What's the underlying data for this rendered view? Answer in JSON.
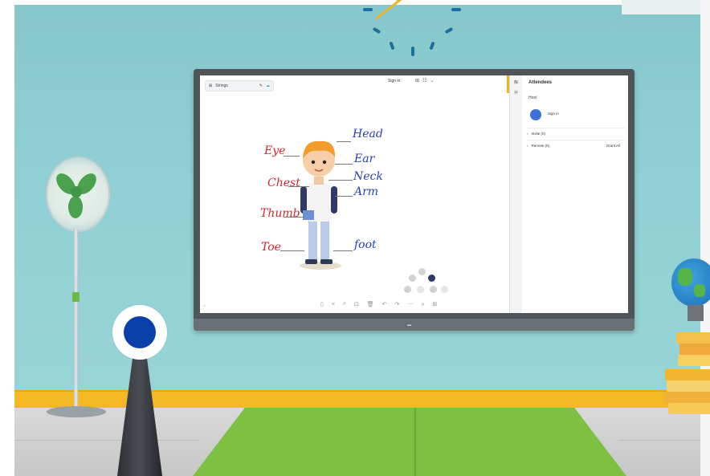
{
  "whiteboard": {
    "toolbar": {
      "icon_left": "⊞",
      "label": "Strings",
      "pen_icon": "✎",
      "cloud_icon": "☁"
    },
    "title": "Sign in",
    "title_icons": [
      "⊞",
      "☷",
      "⌄"
    ]
  },
  "labels": {
    "red": [
      "Eye",
      "Chest",
      "Thumb",
      "Toe"
    ],
    "blue": [
      "Head",
      "Ear",
      "Neck",
      "Arm",
      "foot"
    ]
  },
  "side_panel": {
    "close_icon": "⊟",
    "title": "Attendees",
    "section": "Host",
    "host_name": "Sign in",
    "groups": [
      {
        "label": "Invite (0)",
        "extra": ""
      },
      {
        "label": "Remote (0)",
        "extra": "Grant All"
      }
    ]
  },
  "tools_column": [
    "✎",
    "Ⓜ"
  ],
  "bottom_toolbar": {
    "left_mark": "⌂",
    "icons": [
      "▯",
      "<",
      "⌕",
      "⊡",
      "🗑",
      "↶",
      "↷",
      "⋯",
      "»",
      "⊞"
    ]
  },
  "colors": {
    "wall": "#8fcfd3",
    "baseboard": "#f4b824",
    "mat": "#7ec142",
    "ink_red": "#d4262c",
    "ink_blue": "#2a3fbf",
    "accent_blue": "#0b3fa8"
  }
}
